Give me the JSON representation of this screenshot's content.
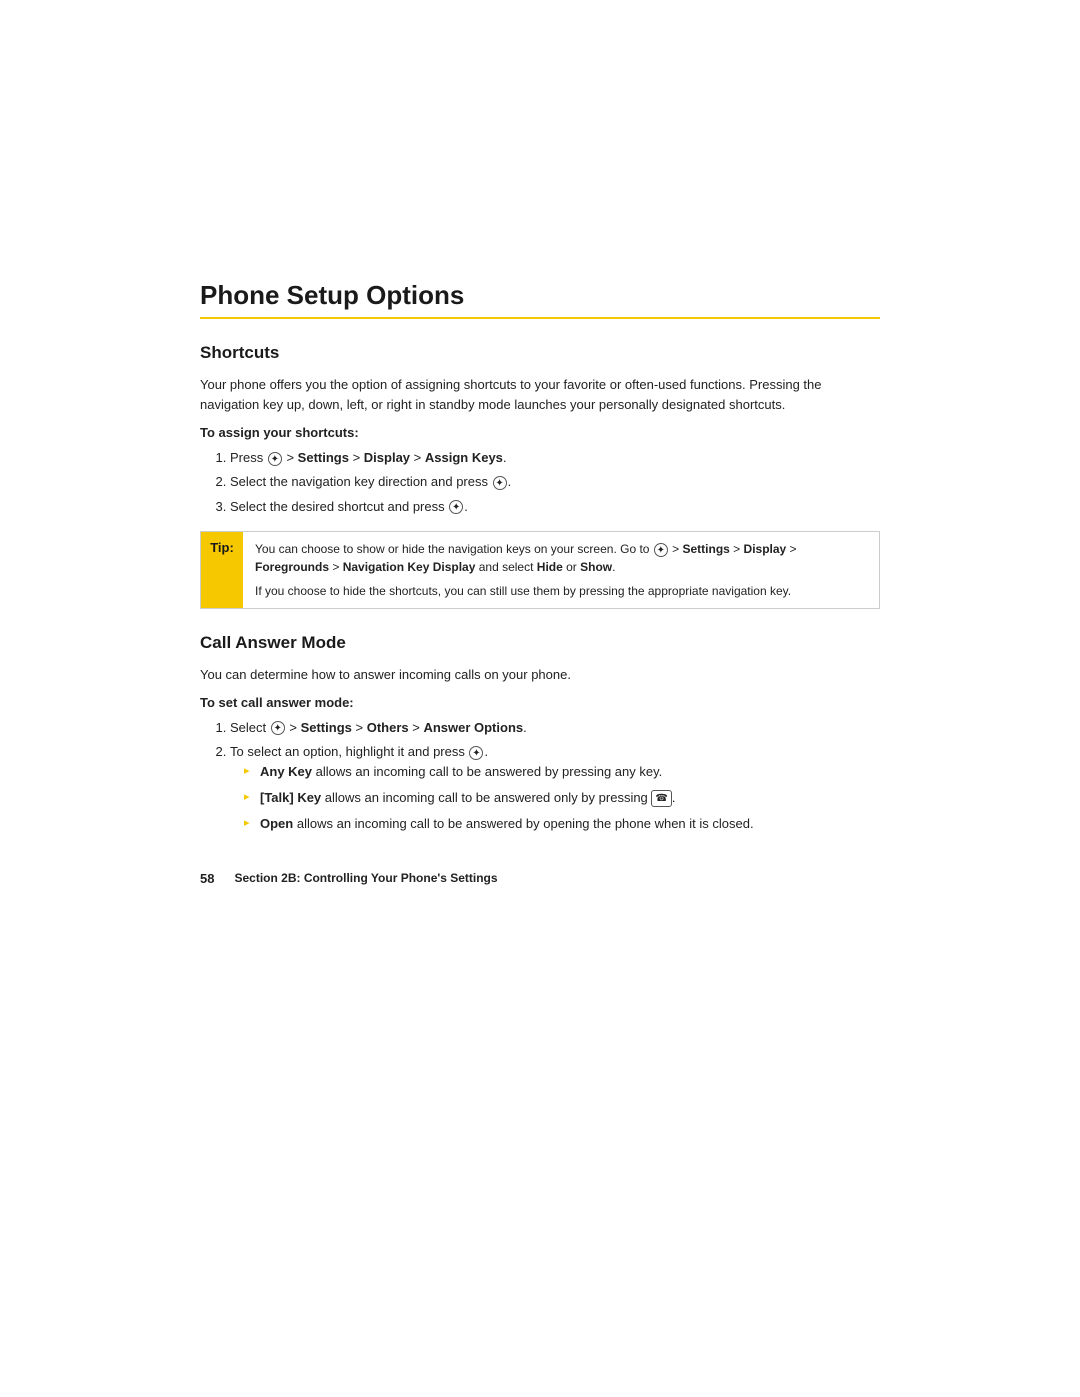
{
  "page": {
    "title": "Phone Setup Options",
    "title_underline_color": "#f5c800"
  },
  "shortcuts_section": {
    "heading": "Shortcuts",
    "intro": "Your phone offers you the option of assigning shortcuts to your favorite or often-used functions. Pressing the navigation key up, down, left, or right in standby mode launches your personally designated shortcuts.",
    "subheading": "To assign your shortcuts:",
    "steps": [
      "Press ✦ > Settings > Display > Assign Keys.",
      "Select the navigation key direction and press ✦.",
      "Select the desired shortcut and press ✦."
    ],
    "tip_label": "Tip:",
    "tip_paragraphs": [
      "You can choose to show or hide the navigation keys on your screen. Go to ✦ > Settings > Display > Foregrounds > Navigation Key Display and select Hide or Show.",
      "If you choose to hide the shortcuts, you can still use them by pressing the appropriate navigation key."
    ]
  },
  "call_answer_section": {
    "heading": "Call Answer Mode",
    "intro": "You can determine how to answer incoming calls on your phone.",
    "subheading": "To set call answer mode:",
    "steps": [
      "Select ✦ > Settings > Others > Answer Options.",
      "To select an option, highlight it and press ✦."
    ],
    "bullet_items": [
      "Any Key allows an incoming call to be answered by pressing any key.",
      "[Talk] Key allows an incoming call to be answered only by pressing ☎.",
      "Open allows an incoming call to be answered by opening the phone when it is closed."
    ]
  },
  "footer": {
    "page_number": "58",
    "section_label": "Section 2B: Controlling Your Phone's Settings"
  }
}
